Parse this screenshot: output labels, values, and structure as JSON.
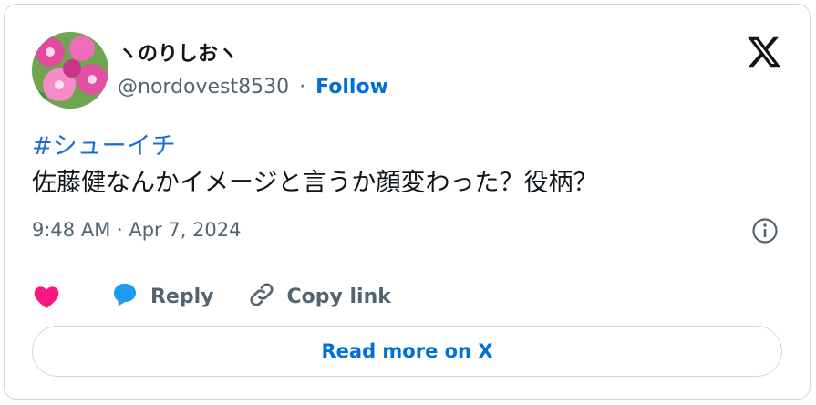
{
  "author": {
    "display_name": "ヽのりしおヽ",
    "handle": "@nordovest8530",
    "separator": "·",
    "follow_label": "Follow"
  },
  "tweet": {
    "hashtag": "#シューイチ",
    "text": "佐藤健なんかイメージと言うか顔変わった？役柄？",
    "timestamp": "9:48 AM · Apr 7, 2024"
  },
  "actions": {
    "reply_label": "Reply",
    "copy_link_label": "Copy link"
  },
  "footer": {
    "read_more_label": "Read more on X"
  },
  "colors": {
    "link": "#006fd6",
    "like": "#f91880",
    "reply": "#1d9bf0",
    "muted": "#536471",
    "border": "#cfd9de"
  },
  "icons": [
    "x-logo-icon",
    "info-icon",
    "heart-icon",
    "reply-bubble-icon",
    "link-icon"
  ]
}
